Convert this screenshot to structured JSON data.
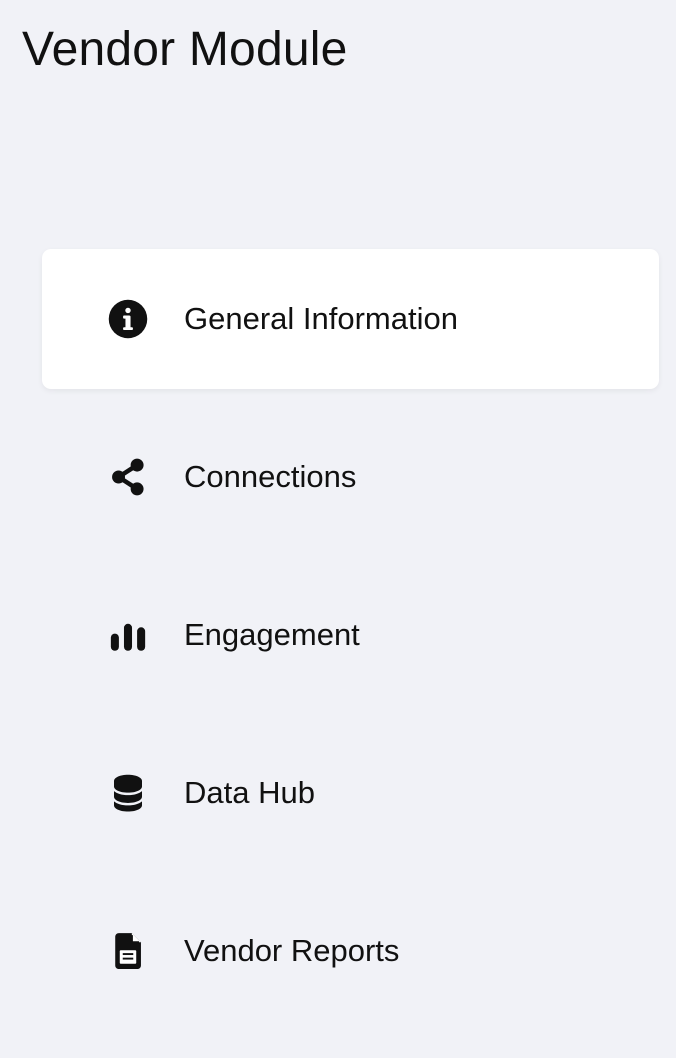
{
  "header": {
    "title": "Vendor Module"
  },
  "navigation": {
    "active_item": "General Information",
    "items": [
      {
        "label": "General Information",
        "icon": "info-icon"
      },
      {
        "label": "Connections",
        "icon": "share-icon"
      },
      {
        "label": "Engagement",
        "icon": "bar-chart-icon"
      },
      {
        "label": "Data Hub",
        "icon": "database-icon"
      },
      {
        "label": "Vendor Reports",
        "icon": "document-icon"
      }
    ]
  },
  "colors": {
    "background": "#f1f2f7",
    "active_item_background": "#ffffff",
    "text": "#111111"
  }
}
